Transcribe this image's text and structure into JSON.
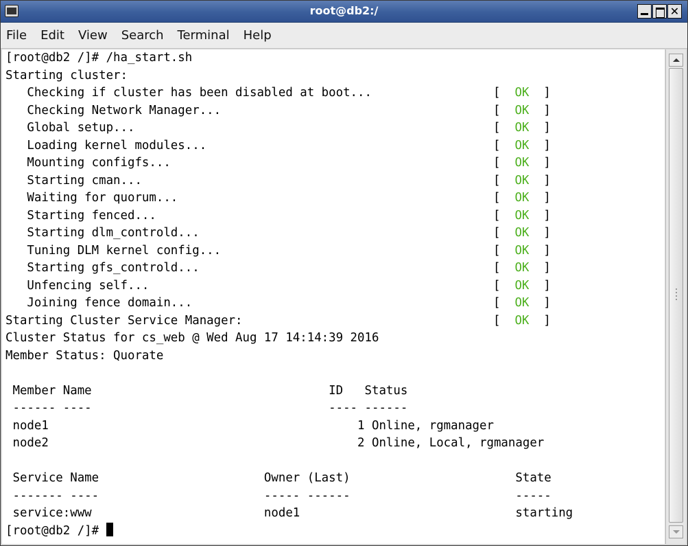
{
  "window": {
    "title": "root@db2:/"
  },
  "menu": [
    "File",
    "Edit",
    "View",
    "Search",
    "Terminal",
    "Help"
  ],
  "terminal": {
    "lines": [
      "[root@db2 /]# /ha_start.sh",
      "Starting cluster:",
      "   Checking if cluster has been disabled at boot...",
      "   Checking Network Manager...",
      "   Global setup...",
      "   Loading kernel modules...",
      "   Mounting configfs...",
      "   Starting cman...",
      "   Waiting for quorum...",
      "   Starting fenced...",
      "   Starting dlm_controld...",
      "   Tuning DLM kernel config...",
      "   Starting gfs_controld...",
      "   Unfencing self...",
      "   Joining fence domain...",
      "Starting Cluster Service Manager:",
      "Cluster Status for cs_web @ Wed Aug 17 14:14:39 2016",
      "Member Status: Quorate",
      "",
      " Member Name                                 ID   Status",
      " ------ ----                                 ---- ------",
      " node1                                           1 Online, rgmanager",
      " node2                                           2 Online, Local, rgmanager",
      "",
      " Service Name                       Owner (Last)                       State",
      " ------- ----                       ----- ------                       -----",
      " service:www                        node1                              starting"
    ],
    "status_open": "[",
    "status_ok": "OK",
    "status_close": "]",
    "ok_line_count": 14,
    "prompt": "[root@db2 /]# ",
    "ok_color": "#4db01e"
  }
}
